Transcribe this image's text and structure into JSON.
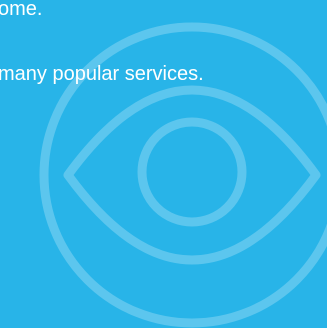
{
  "colors": {
    "background": "#28B4E8",
    "text": "#FFFFFF",
    "watermark_stroke": "#5CC6EE"
  },
  "content": {
    "line_1": "ome.",
    "line_2": "many popular services."
  },
  "watermark": {
    "icon": "eye-icon"
  }
}
